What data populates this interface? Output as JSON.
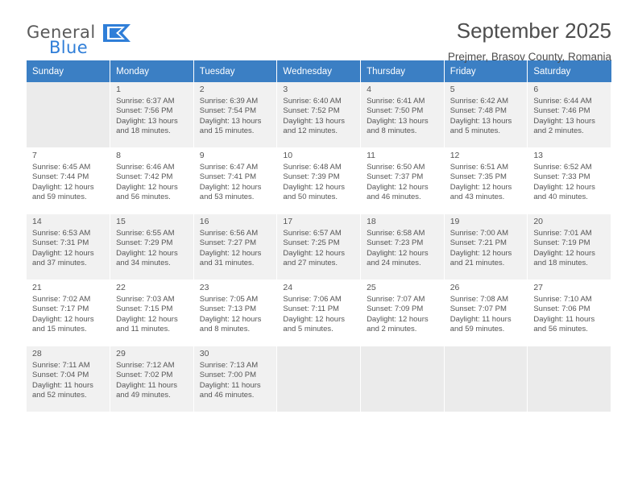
{
  "brand": {
    "name_top": "General",
    "name_bottom": "Blue",
    "flag_colors": [
      "#2f7ed8",
      "#ffffff"
    ]
  },
  "header": {
    "title": "September 2025",
    "subtitle": "Prejmer, Brasov County, Romania",
    "accent": "#3b7fc4"
  },
  "calendar": {
    "weekday_headers": [
      "Sunday",
      "Monday",
      "Tuesday",
      "Wednesday",
      "Thursday",
      "Friday",
      "Saturday"
    ],
    "weeks": [
      [
        {
          "day": "",
          "info": ""
        },
        {
          "day": "1",
          "info": "Sunrise: 6:37 AM\nSunset: 7:56 PM\nDaylight: 13 hours\nand 18 minutes."
        },
        {
          "day": "2",
          "info": "Sunrise: 6:39 AM\nSunset: 7:54 PM\nDaylight: 13 hours\nand 15 minutes."
        },
        {
          "day": "3",
          "info": "Sunrise: 6:40 AM\nSunset: 7:52 PM\nDaylight: 13 hours\nand 12 minutes."
        },
        {
          "day": "4",
          "info": "Sunrise: 6:41 AM\nSunset: 7:50 PM\nDaylight: 13 hours\nand 8 minutes."
        },
        {
          "day": "5",
          "info": "Sunrise: 6:42 AM\nSunset: 7:48 PM\nDaylight: 13 hours\nand 5 minutes."
        },
        {
          "day": "6",
          "info": "Sunrise: 6:44 AM\nSunset: 7:46 PM\nDaylight: 13 hours\nand 2 minutes."
        }
      ],
      [
        {
          "day": "7",
          "info": "Sunrise: 6:45 AM\nSunset: 7:44 PM\nDaylight: 12 hours\nand 59 minutes."
        },
        {
          "day": "8",
          "info": "Sunrise: 6:46 AM\nSunset: 7:42 PM\nDaylight: 12 hours\nand 56 minutes."
        },
        {
          "day": "9",
          "info": "Sunrise: 6:47 AM\nSunset: 7:41 PM\nDaylight: 12 hours\nand 53 minutes."
        },
        {
          "day": "10",
          "info": "Sunrise: 6:48 AM\nSunset: 7:39 PM\nDaylight: 12 hours\nand 50 minutes."
        },
        {
          "day": "11",
          "info": "Sunrise: 6:50 AM\nSunset: 7:37 PM\nDaylight: 12 hours\nand 46 minutes."
        },
        {
          "day": "12",
          "info": "Sunrise: 6:51 AM\nSunset: 7:35 PM\nDaylight: 12 hours\nand 43 minutes."
        },
        {
          "day": "13",
          "info": "Sunrise: 6:52 AM\nSunset: 7:33 PM\nDaylight: 12 hours\nand 40 minutes."
        }
      ],
      [
        {
          "day": "14",
          "info": "Sunrise: 6:53 AM\nSunset: 7:31 PM\nDaylight: 12 hours\nand 37 minutes."
        },
        {
          "day": "15",
          "info": "Sunrise: 6:55 AM\nSunset: 7:29 PM\nDaylight: 12 hours\nand 34 minutes."
        },
        {
          "day": "16",
          "info": "Sunrise: 6:56 AM\nSunset: 7:27 PM\nDaylight: 12 hours\nand 31 minutes."
        },
        {
          "day": "17",
          "info": "Sunrise: 6:57 AM\nSunset: 7:25 PM\nDaylight: 12 hours\nand 27 minutes."
        },
        {
          "day": "18",
          "info": "Sunrise: 6:58 AM\nSunset: 7:23 PM\nDaylight: 12 hours\nand 24 minutes."
        },
        {
          "day": "19",
          "info": "Sunrise: 7:00 AM\nSunset: 7:21 PM\nDaylight: 12 hours\nand 21 minutes."
        },
        {
          "day": "20",
          "info": "Sunrise: 7:01 AM\nSunset: 7:19 PM\nDaylight: 12 hours\nand 18 minutes."
        }
      ],
      [
        {
          "day": "21",
          "info": "Sunrise: 7:02 AM\nSunset: 7:17 PM\nDaylight: 12 hours\nand 15 minutes."
        },
        {
          "day": "22",
          "info": "Sunrise: 7:03 AM\nSunset: 7:15 PM\nDaylight: 12 hours\nand 11 minutes."
        },
        {
          "day": "23",
          "info": "Sunrise: 7:05 AM\nSunset: 7:13 PM\nDaylight: 12 hours\nand 8 minutes."
        },
        {
          "day": "24",
          "info": "Sunrise: 7:06 AM\nSunset: 7:11 PM\nDaylight: 12 hours\nand 5 minutes."
        },
        {
          "day": "25",
          "info": "Sunrise: 7:07 AM\nSunset: 7:09 PM\nDaylight: 12 hours\nand 2 minutes."
        },
        {
          "day": "26",
          "info": "Sunrise: 7:08 AM\nSunset: 7:07 PM\nDaylight: 11 hours\nand 59 minutes."
        },
        {
          "day": "27",
          "info": "Sunrise: 7:10 AM\nSunset: 7:06 PM\nDaylight: 11 hours\nand 56 minutes."
        }
      ],
      [
        {
          "day": "28",
          "info": "Sunrise: 7:11 AM\nSunset: 7:04 PM\nDaylight: 11 hours\nand 52 minutes."
        },
        {
          "day": "29",
          "info": "Sunrise: 7:12 AM\nSunset: 7:02 PM\nDaylight: 11 hours\nand 49 minutes."
        },
        {
          "day": "30",
          "info": "Sunrise: 7:13 AM\nSunset: 7:00 PM\nDaylight: 11 hours\nand 46 minutes."
        },
        {
          "day": "",
          "info": ""
        },
        {
          "day": "",
          "info": ""
        },
        {
          "day": "",
          "info": ""
        },
        {
          "day": "",
          "info": ""
        }
      ]
    ]
  }
}
